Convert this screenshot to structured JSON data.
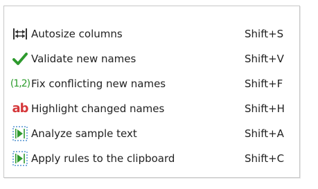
{
  "menu": {
    "items": [
      {
        "icon": "autosize-columns-icon",
        "label": "Autosize columns",
        "shortcut": "Shift+S"
      },
      {
        "icon": "checkmark-icon",
        "label": "Validate new names",
        "shortcut": "Shift+V"
      },
      {
        "icon": "conflict-coordinates-icon",
        "icon_text": "(1,2)",
        "label": "Fix conflicting new names",
        "shortcut": "Shift+F"
      },
      {
        "icon": "highlight-ab-icon",
        "icon_text": "ab",
        "label": "Highlight changed names",
        "shortcut": "Shift+H"
      },
      {
        "icon": "analyze-text-icon",
        "label": "Analyze sample text",
        "shortcut": "Shift+A"
      },
      {
        "icon": "apply-rules-clipboard-icon",
        "label": "Apply rules to the clipboard",
        "shortcut": "Shift+C"
      }
    ]
  },
  "colors": {
    "check_green": "#2e9a2e",
    "highlight_red": "#d5373a",
    "accent_blue": "#2d7cc8",
    "border": "#c7c7c7",
    "text": "#222222"
  }
}
